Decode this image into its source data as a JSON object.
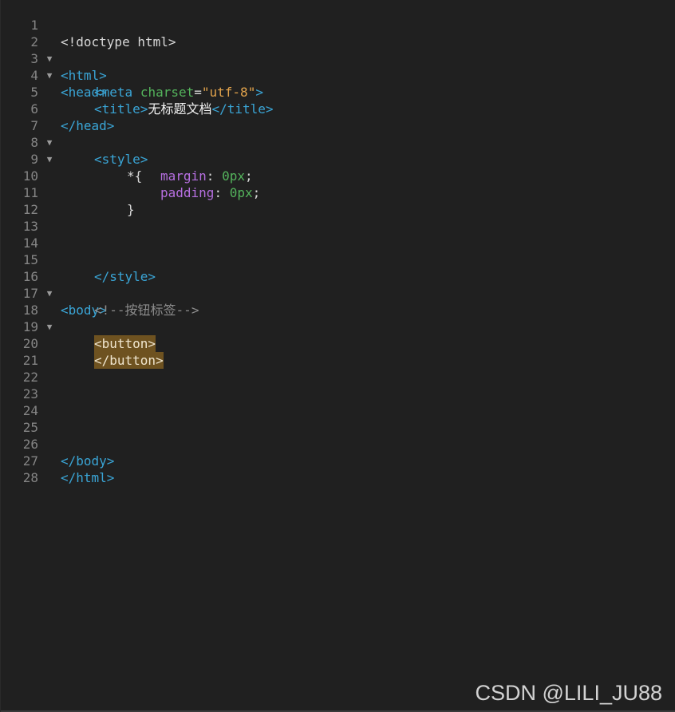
{
  "editor": {
    "line_numbers": [
      "1",
      "2",
      "3",
      "4",
      "5",
      "6",
      "7",
      "8",
      "9",
      "10",
      "11",
      "12",
      "13",
      "14",
      "15",
      "16",
      "17",
      "18",
      "19",
      "20",
      "21",
      "22",
      "23",
      "24",
      "25",
      "26",
      "27",
      "28"
    ],
    "fold_marker": "▼",
    "lines": {
      "l1": "<!doctype html>",
      "l2": "<html>",
      "l3": "<head>",
      "l4_tag_open": "<meta",
      "l4_attr": "charset",
      "l4_eq": "=",
      "l4_val": "\"utf-8\"",
      "l4_close": ">",
      "l5_open": "<title>",
      "l5_text": "无标题文档",
      "l5_close": "</title>",
      "l6": "</head>",
      "l7": "<style>",
      "l8": "*{",
      "l9_prop": "margin",
      "l9_colon": ":",
      "l9_val": "0px",
      "l9_semi": ";",
      "l10_prop": "padding",
      "l10_colon": ":",
      "l10_val": "0px",
      "l10_semi": ";",
      "l11": "}",
      "l15": "</style>",
      "l16": "<body>",
      "l17_open": "<!--",
      "l17_text": "按钮标签",
      "l17_close": "-->",
      "l18": "<button>",
      "l20": "</button>",
      "l26": "</body>",
      "l27": "</html>"
    },
    "colors": {
      "background": "#202020",
      "tag": "#3aa5d6",
      "attribute": "#54b45c",
      "string": "#e3a44c",
      "property": "#b66fe0",
      "highlight": "#6e5220"
    }
  },
  "watermark": "CSDN @LILI_JU88"
}
